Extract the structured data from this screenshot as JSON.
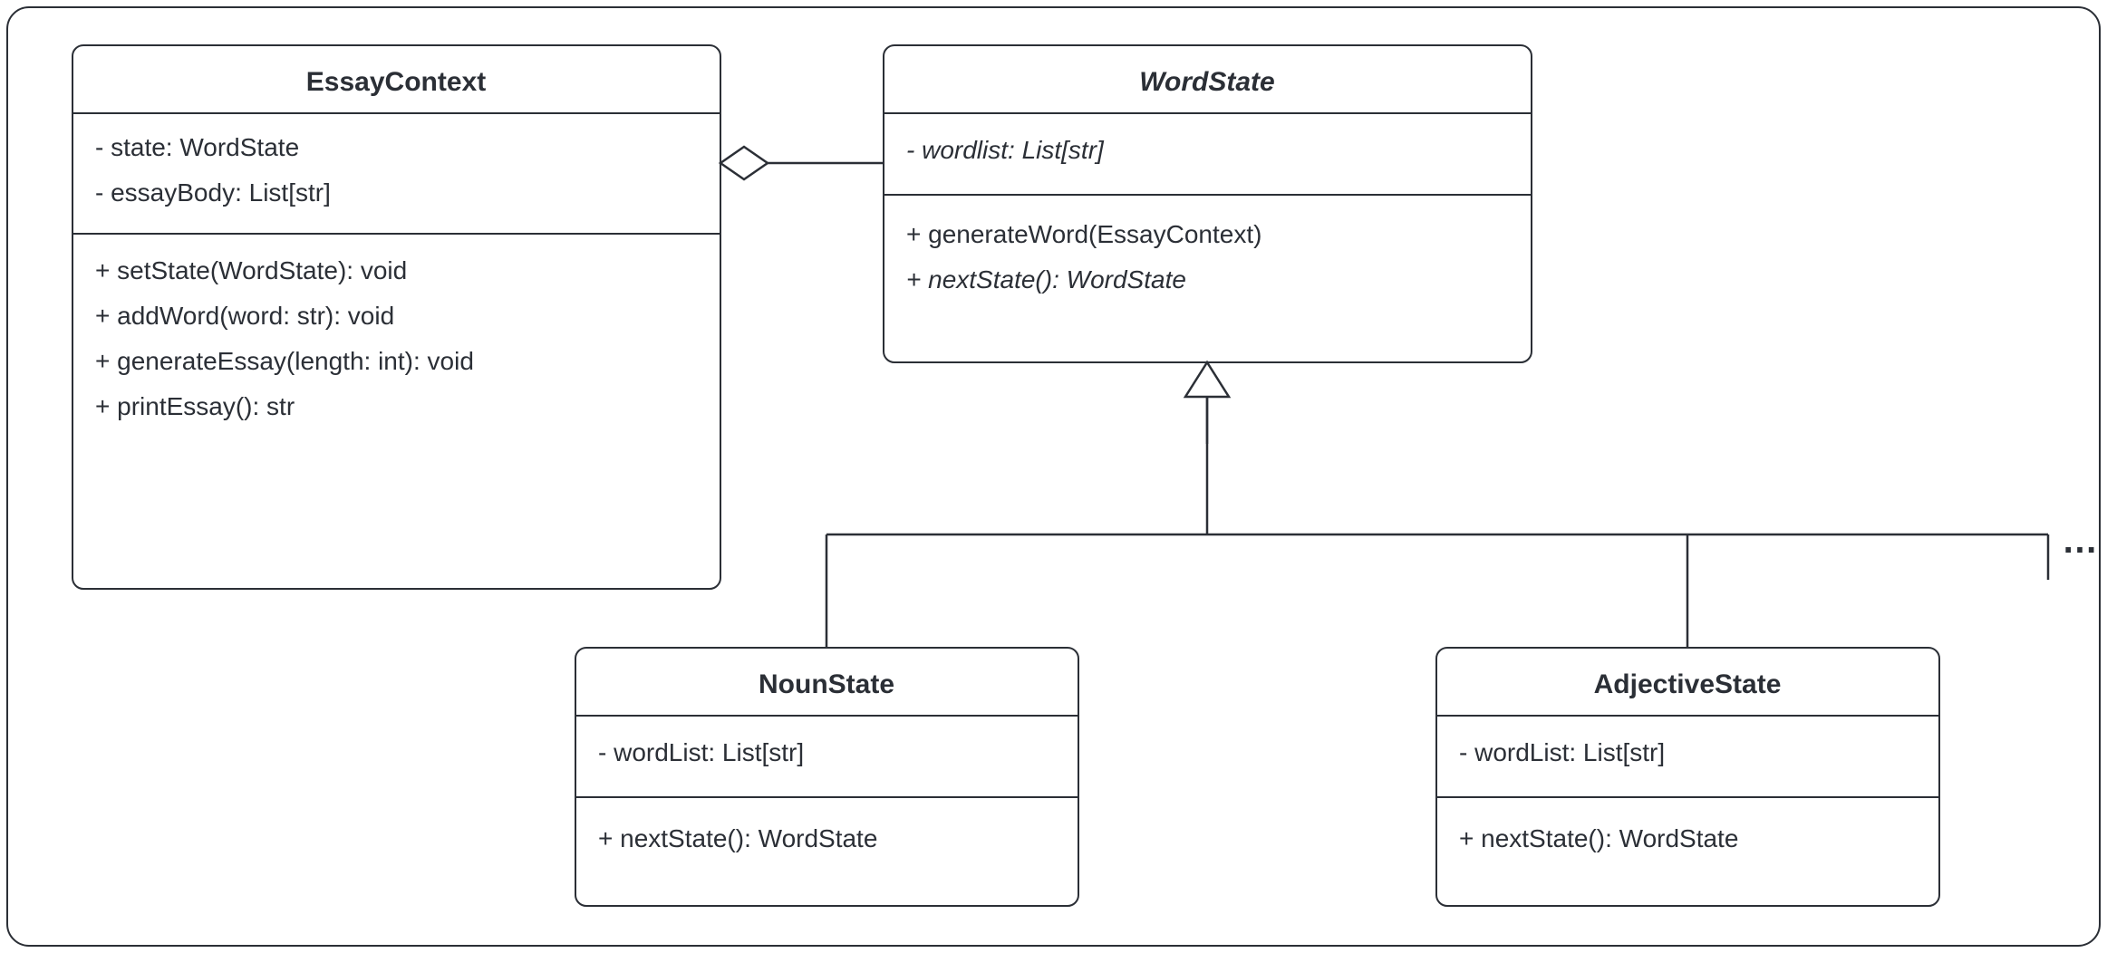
{
  "diagram": {
    "ellipsis": "…",
    "classes": {
      "essayContext": {
        "name": "EssayContext",
        "abstract": false,
        "attributes": [
          "- state: WordState",
          "- essayBody: List[str]"
        ],
        "operations": [
          "+ setState(WordState): void",
          "+ addWord(word: str): void",
          "+ generateEssay(length: int): void",
          "+ printEssay(): str"
        ]
      },
      "wordState": {
        "name": "WordState",
        "abstract": true,
        "attributes": [
          {
            "text": "- wordlist: List[str]",
            "italic": true
          }
        ],
        "operations": [
          {
            "text": "+ generateWord(EssayContext)",
            "italic": false
          },
          {
            "text": "+ nextState(): WordState",
            "italic": true
          }
        ]
      },
      "nounState": {
        "name": "NounState",
        "abstract": false,
        "attributes": [
          "- wordList: List[str]"
        ],
        "operations": [
          "+ nextState(): WordState"
        ]
      },
      "adjectiveState": {
        "name": "AdjectiveState",
        "abstract": false,
        "attributes": [
          "- wordList: List[str]"
        ],
        "operations": [
          "+ nextState(): WordState"
        ]
      }
    },
    "relationships": [
      {
        "type": "aggregation",
        "from": "EssayContext",
        "to": "WordState"
      },
      {
        "type": "generalization",
        "parent": "WordState",
        "children": [
          "NounState",
          "AdjectiveState",
          "…"
        ]
      }
    ]
  }
}
